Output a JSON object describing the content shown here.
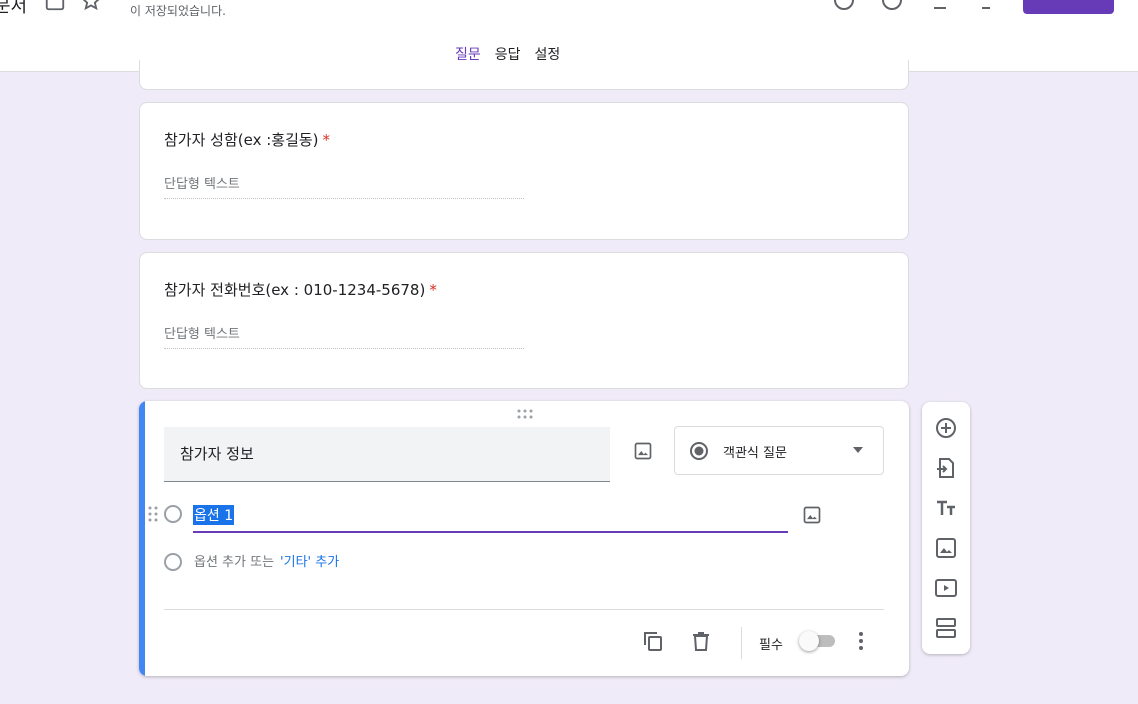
{
  "header": {
    "title_fragment": "문서",
    "save_status": "이 저장되었습니다.",
    "tabs": [
      {
        "label": "질문",
        "active": true
      },
      {
        "label": "응답",
        "active": false
      },
      {
        "label": "설정",
        "active": false
      }
    ],
    "accent_color": "#673ab7"
  },
  "questions": [
    {
      "title": "참가자 성함(ex :홍길동)",
      "required_mark": "*",
      "answer_placeholder": "단답형 텍스트"
    },
    {
      "title": "참가자 전화번호(ex : 010-1234-5678)",
      "required_mark": "*",
      "answer_placeholder": "단답형 텍스트"
    }
  ],
  "active_question": {
    "title": "참가자 정보",
    "type_label": "객관식 질문",
    "option_1": "옵션 1",
    "add_option": "옵션 추가 또는",
    "add_other": "'기타' 추가",
    "required_label": "필수",
    "required_on": false
  },
  "icons": {
    "side_toolbar": [
      "add-question-icon",
      "import-questions-icon",
      "add-title-icon",
      "add-image-icon",
      "add-video-icon",
      "add-section-icon"
    ],
    "footer": [
      "duplicate-icon",
      "delete-icon",
      "more-vert-icon"
    ]
  }
}
